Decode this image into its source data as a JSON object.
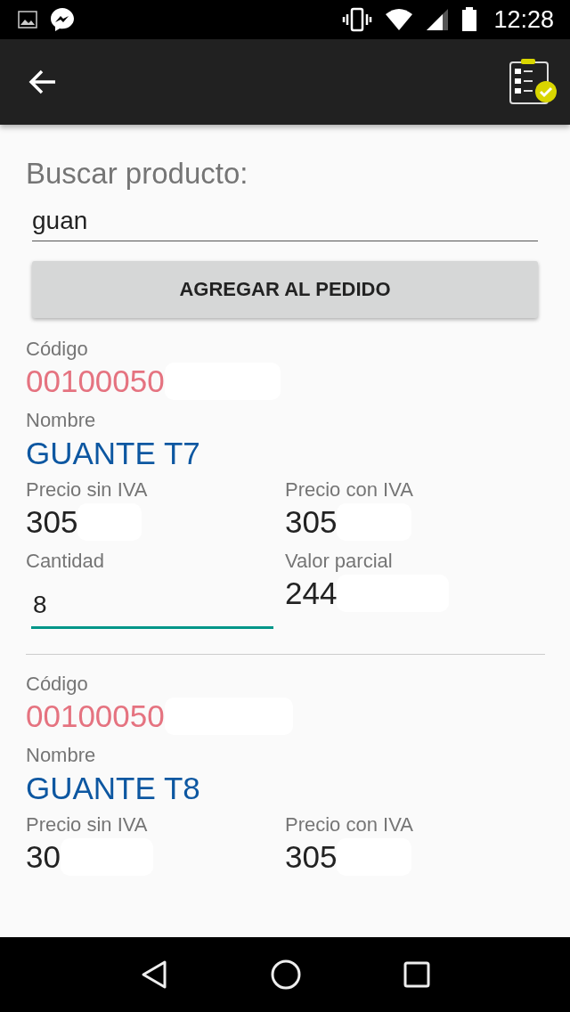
{
  "status_bar": {
    "time": "12:28"
  },
  "search": {
    "label": "Buscar producto:",
    "value": "guan"
  },
  "add_button": "AGREGAR AL PEDIDO",
  "products": [
    {
      "code_label": "Código",
      "code": "00100050",
      "name_label": "Nombre",
      "name": "GUANTE T7",
      "price_label": "Precio sin IVA",
      "price": "305",
      "price_iva_label": "Precio con IVA",
      "price_iva": "305",
      "qty_label": "Cantidad",
      "qty": "8",
      "subtotal_label": "Valor parcial",
      "subtotal": "244"
    },
    {
      "code_label": "Código",
      "code": "00100050",
      "name_label": "Nombre",
      "name": "GUANTE T8",
      "price_label": "Precio sin IVA",
      "price": "30",
      "price_iva_label": "Precio con IVA",
      "price_iva": "305"
    }
  ]
}
